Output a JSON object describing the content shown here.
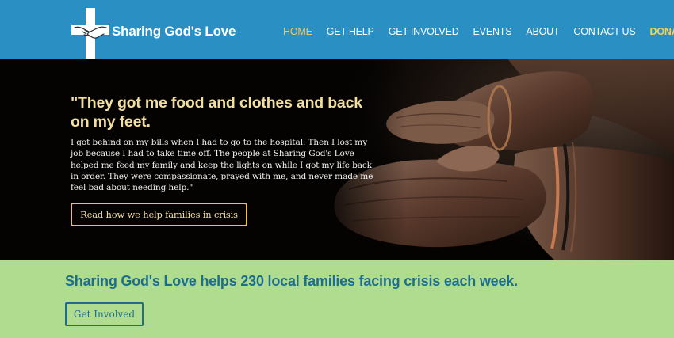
{
  "brand": {
    "name": "Sharing God's Love",
    "logo_icon": "cross-handshake-icon"
  },
  "nav": {
    "items": [
      {
        "label": "HOME",
        "active": true
      },
      {
        "label": "GET HELP"
      },
      {
        "label": "GET INVOLVED"
      },
      {
        "label": "EVENTS"
      },
      {
        "label": "ABOUT"
      },
      {
        "label": "CONTACT US"
      },
      {
        "label": "DONATE",
        "highlight": true
      }
    ]
  },
  "hero": {
    "quote": "\"They got me food and clothes and back on my feet.",
    "body": "I got behind on my bills when I had to go to the hospital. Then I lost my job because I had to take time off. The people at Sharing God's Love helped me feed my family and keep the lights on while I got my life back in order. They were compassionate, prayed with me, and never made me feel bad about needing help.\"",
    "button_label": "Read how we help families in crisis",
    "image_icon": "cupped-hands-photo"
  },
  "banner": {
    "text": "Sharing God's Love helps 230 local families facing crisis each week.",
    "button_label": "Get Involved"
  },
  "colors": {
    "header_bg": "#2a8fc3",
    "nav_active": "#e8c96a",
    "hero_bg": "#040302",
    "hero_accent": "#e5c35e",
    "banner_bg": "#b0dc90",
    "banner_text": "#1c6e8a"
  }
}
